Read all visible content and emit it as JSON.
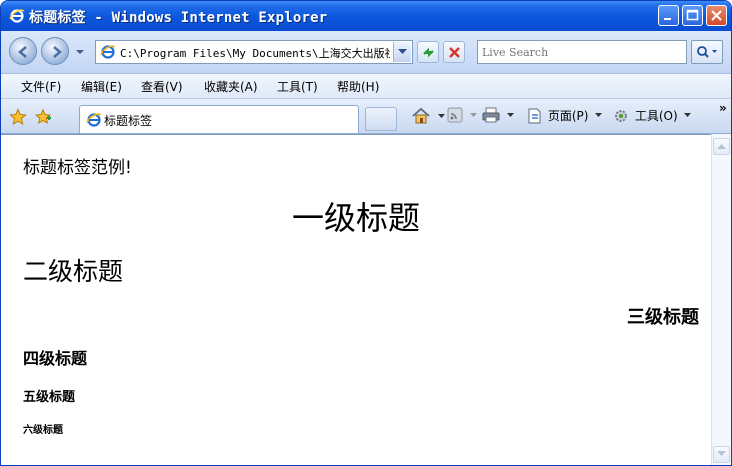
{
  "window": {
    "title": "标题标签 - Windows Internet Explorer"
  },
  "addressbar": {
    "url": "C:\\Program Files\\My Documents\\上海交大出版社",
    "search_placeholder": "Live Search"
  },
  "menubar": {
    "items": [
      "文件(F)",
      "编辑(E)",
      "查看(V)",
      "收藏夹(A)",
      "工具(T)",
      "帮助(H)"
    ]
  },
  "tabbar": {
    "tab_label": "标题标签",
    "page_label": "页面(P)",
    "tools_label": "工具(O)",
    "more": "»"
  },
  "content": {
    "intro": "标题标签范例!",
    "h1": "一级标题",
    "h2": "二级标题",
    "h3": "三级标题",
    "h4": "四级标题",
    "h5": "五级标题",
    "h6": "六级标题"
  },
  "colors": {
    "titlebar": "#0b56dc",
    "close_button": "#d34b2a",
    "background": "#ffffff"
  },
  "icons": [
    "ie-icon",
    "back-arrow-icon",
    "forward-arrow-icon",
    "refresh-icon",
    "stop-icon",
    "search-icon",
    "favorites-star-icon",
    "add-favorites-icon",
    "home-icon",
    "feeds-icon",
    "print-icon",
    "page-icon",
    "tools-gear-icon",
    "minimize-icon",
    "maximize-icon",
    "close-icon"
  ]
}
